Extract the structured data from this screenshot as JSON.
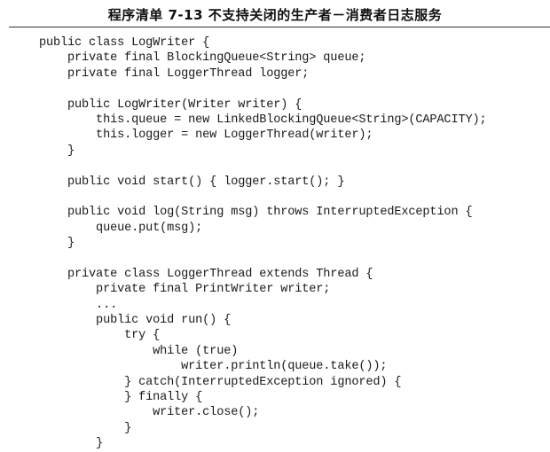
{
  "header": {
    "title": "程序清单 7-13   不支持关闭的生产者－消费者日志服务"
  },
  "code": {
    "lines": [
      "public class LogWriter {",
      "    private final BlockingQueue<String> queue;",
      "    private final LoggerThread logger;",
      "",
      "    public LogWriter(Writer writer) {",
      "        this.queue = new LinkedBlockingQueue<String>(CAPACITY);",
      "        this.logger = new LoggerThread(writer);",
      "    }",
      "",
      "    public void start() { logger.start(); }",
      "",
      "    public void log(String msg) throws InterruptedException {",
      "        queue.put(msg);",
      "    }",
      "",
      "    private class LoggerThread extends Thread {",
      "        private final PrintWriter writer;",
      "        ...",
      "        public void run() {",
      "            try {",
      "                while (true)",
      "                    writer.println(queue.take());",
      "            } catch(InterruptedException ignored) {",
      "            } finally {",
      "                writer.close();",
      "            }",
      "        }"
    ]
  }
}
